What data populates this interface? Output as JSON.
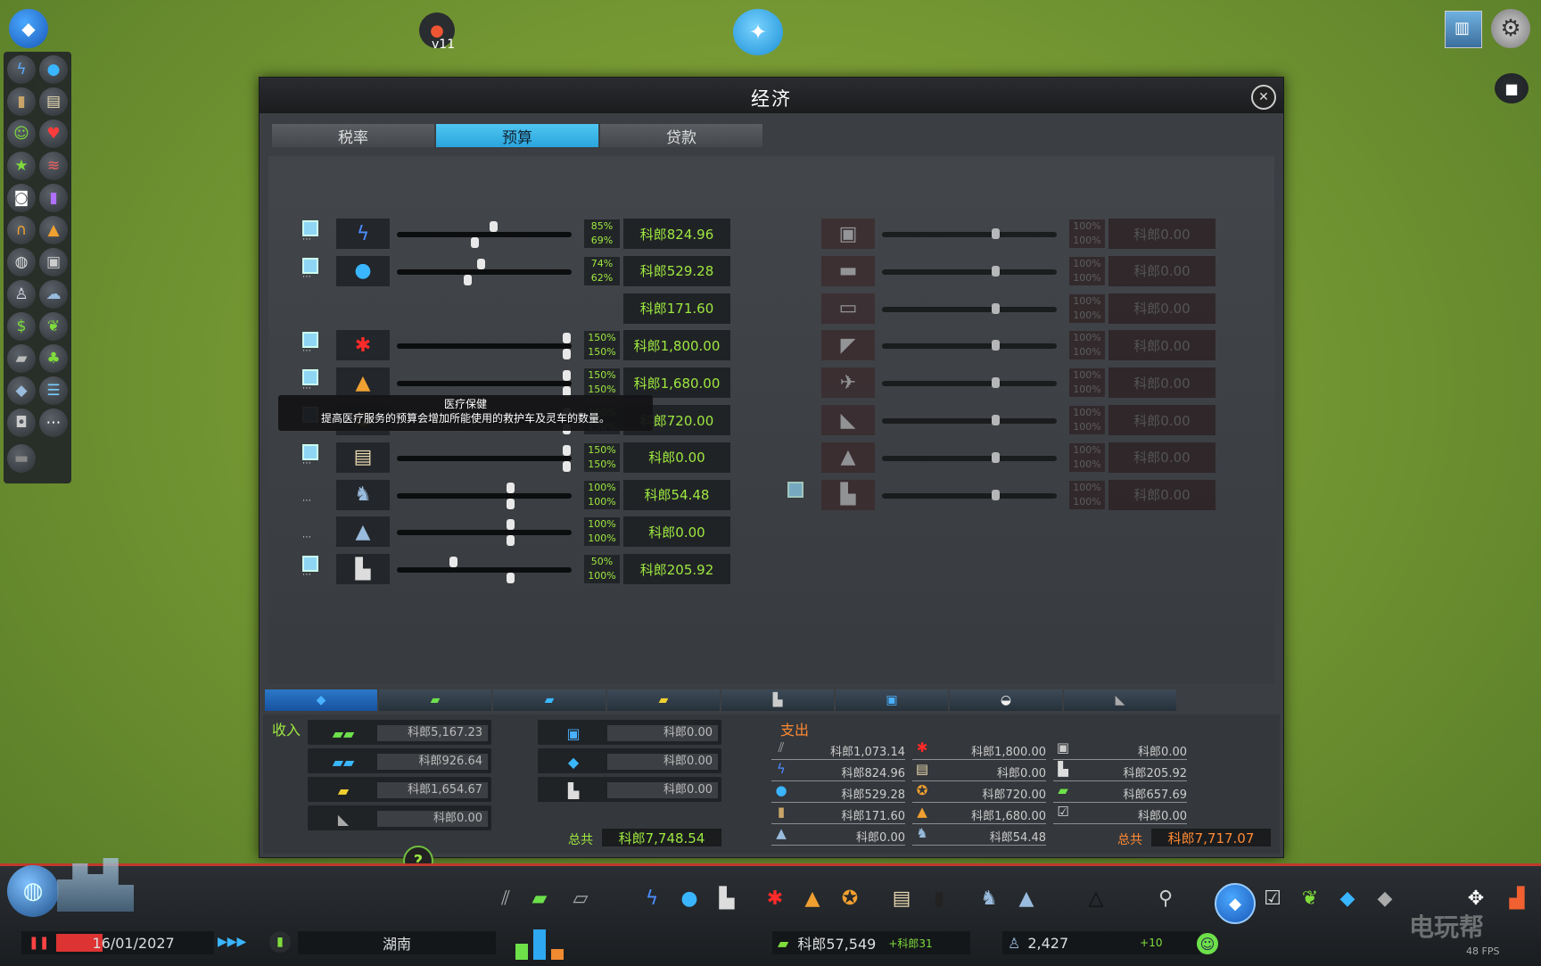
{
  "top": {
    "version_label": "v11"
  },
  "window": {
    "title": "经济",
    "tabs": [
      "税率",
      "预算",
      "贷款"
    ],
    "active_tab": "预算"
  },
  "tooltip": {
    "title": "医疗保健",
    "text": "提高医疗服务的预算会增加所能使用的救护车及灵车的数量。"
  },
  "budget_left": [
    {
      "name": "electricity",
      "icon": "lightning-icon",
      "day": "85%",
      "night": "69%",
      "value": "科郎824.96",
      "day_level": 0.85,
      "night_level": 0.69,
      "check": true
    },
    {
      "name": "water",
      "icon": "water-drop-icon",
      "day": "74%",
      "night": "62%",
      "value": "科郎529.28",
      "day_level": 0.74,
      "night_level": 0.62,
      "check": true
    },
    {
      "name": "garbage",
      "icon": "garbage-icon",
      "day": "",
      "night": "",
      "value": "科郎171.60",
      "day_level": 0,
      "night_level": 0,
      "check": false
    },
    {
      "name": "healthcare",
      "icon": "medical-cross-icon",
      "day": "150%",
      "night": "150%",
      "value": "科郎1,800.00",
      "day_level": 1.5,
      "night_level": 1.5,
      "check": true
    },
    {
      "name": "fire",
      "icon": "fire-helmet-icon",
      "day": "150%",
      "night": "150%",
      "value": "科郎1,680.00",
      "day_level": 1.5,
      "night_level": 1.5,
      "check": true
    },
    {
      "name": "police",
      "icon": "police-badge-icon",
      "day": "150%",
      "night": "150%",
      "value": "科郎720.00",
      "day_level": 1.5,
      "night_level": 1.5,
      "check": true
    },
    {
      "name": "education",
      "icon": "book-icon",
      "day": "150%",
      "night": "150%",
      "value": "科郎0.00",
      "day_level": 1.5,
      "night_level": 1.5,
      "check": true
    },
    {
      "name": "parks",
      "icon": "statue-icon",
      "day": "100%",
      "night": "100%",
      "value": "科郎54.48",
      "day_level": 1.0,
      "night_level": 1.0,
      "check": false
    },
    {
      "name": "monuments",
      "icon": "monument-icon",
      "day": "100%",
      "night": "100%",
      "value": "科郎0.00",
      "day_level": 1.0,
      "night_level": 1.0,
      "check": false
    },
    {
      "name": "industry",
      "icon": "factory-icon",
      "day": "50%",
      "night": "100%",
      "value": "科郎205.92",
      "day_level": 0.5,
      "night_level": 1.0,
      "check": true
    }
  ],
  "budget_right": [
    {
      "name": "bus",
      "icon": "bus-icon",
      "day": "100%",
      "night": "100%",
      "value": "科郎0.00"
    },
    {
      "name": "metro",
      "icon": "metro-icon",
      "day": "100%",
      "night": "100%",
      "value": "科郎0.00"
    },
    {
      "name": "train",
      "icon": "train-icon",
      "day": "100%",
      "night": "100%",
      "value": "科郎0.00"
    },
    {
      "name": "ship",
      "icon": "ship-icon",
      "day": "100%",
      "night": "100%",
      "value": "科郎0.00"
    },
    {
      "name": "plane",
      "icon": "plane-icon",
      "day": "100%",
      "night": "100%",
      "value": "科郎0.00"
    },
    {
      "name": "ferry",
      "icon": "ferry-icon",
      "day": "100%",
      "night": "100%",
      "value": "科郎0.00"
    },
    {
      "name": "taxi",
      "icon": "taxi-icon",
      "day": "100%",
      "night": "100%",
      "value": "科郎0.00"
    },
    {
      "name": "cargo",
      "icon": "truck-icon",
      "day": "100%",
      "night": "100%",
      "value": "科郎0.00"
    }
  ],
  "summary": {
    "income_title": "收入",
    "expense_title": "支出",
    "income": [
      {
        "icon": "residential-icon",
        "value": "科郎5,167.23"
      },
      {
        "icon": "commercial-icon",
        "value": "科郎926.64"
      },
      {
        "icon": "industrial-icon",
        "value": "科郎1,654.67"
      },
      {
        "icon": "office-icon",
        "value": "科郎0.00"
      },
      {
        "icon": "transport-icon",
        "value": "科郎0.00"
      },
      {
        "icon": "tourism-icon",
        "value": "科郎0.00"
      },
      {
        "icon": "factory-icon",
        "value": "科郎0.00"
      }
    ],
    "expenses": [
      {
        "icon": "road-icon",
        "value": "科郎1,073.14"
      },
      {
        "icon": "lightning-icon",
        "value": "科郎824.96"
      },
      {
        "icon": "water-drop-icon",
        "value": "科郎529.28"
      },
      {
        "icon": "garbage-icon",
        "value": "科郎171.60"
      },
      {
        "icon": "monument-icon",
        "value": "科郎0.00"
      },
      {
        "icon": "medical-cross-icon",
        "value": "科郎1,800.00"
      },
      {
        "icon": "book-icon",
        "value": "科郎0.00"
      },
      {
        "icon": "police-badge-icon",
        "value": "科郎720.00"
      },
      {
        "icon": "fire-helmet-icon",
        "value": "科郎1,680.00"
      },
      {
        "icon": "statue-icon",
        "value": "科郎54.48"
      },
      {
        "icon": "bus-icon",
        "value": "科郎0.00"
      },
      {
        "icon": "factory-icon",
        "value": "科郎205.92"
      },
      {
        "icon": "money-icon",
        "value": "科郎657.69"
      },
      {
        "icon": "policy-check-icon",
        "value": "科郎0.00"
      }
    ],
    "total_label": "总共",
    "income_total": "科郎7,748.54",
    "expense_total": "科郎7,717.07"
  },
  "bottom": {
    "date": "16/01/2027",
    "speed_label": "▶▶▶",
    "city_name": "湖南",
    "money": "科郎57,549",
    "money_change": "+科郎31",
    "population": "2,427",
    "population_change": "+10",
    "watermark": "电玩帮",
    "fps": "48 FPS"
  },
  "colors": {
    "accent_blue": "#2aa5dc",
    "income_green": "#9ee840",
    "expense_orange": "#ff8a33",
    "warning_red": "#c0392b"
  }
}
